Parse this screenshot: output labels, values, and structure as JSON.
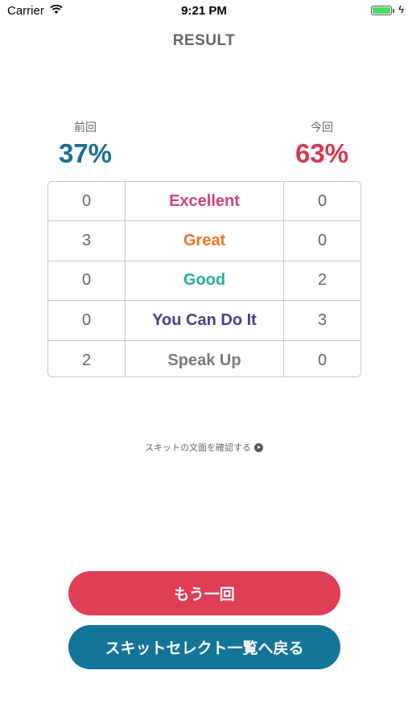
{
  "status_bar": {
    "carrier": "Carrier",
    "time": "9:21 PM"
  },
  "nav": {
    "title": "RESULT"
  },
  "scores": {
    "previous": {
      "label": "前回",
      "value": "37%",
      "color": "#16708f"
    },
    "current": {
      "label": "今回",
      "value": "63%",
      "color": "#d6384f"
    }
  },
  "results": [
    {
      "prev": "0",
      "label": "Excellent",
      "curr": "0",
      "color": "#db3f7c"
    },
    {
      "prev": "3",
      "label": "Great",
      "curr": "0",
      "color": "#ee7426"
    },
    {
      "prev": "0",
      "label": "Good",
      "curr": "2",
      "color": "#1fb0a3"
    },
    {
      "prev": "0",
      "label": "You Can Do It",
      "curr": "3",
      "color": "#4a3d8c"
    },
    {
      "prev": "2",
      "label": "Speak Up",
      "curr": "0",
      "color": "#7a7a7a"
    }
  ],
  "skit_link": {
    "label": "スキットの文面を確認する",
    "icon": "play-circle-icon"
  },
  "buttons": {
    "retry": {
      "label": "もう一回",
      "color": "#e03e56"
    },
    "back": {
      "label": "スキットセレクト一覧へ戻る",
      "color": "#137598"
    }
  }
}
